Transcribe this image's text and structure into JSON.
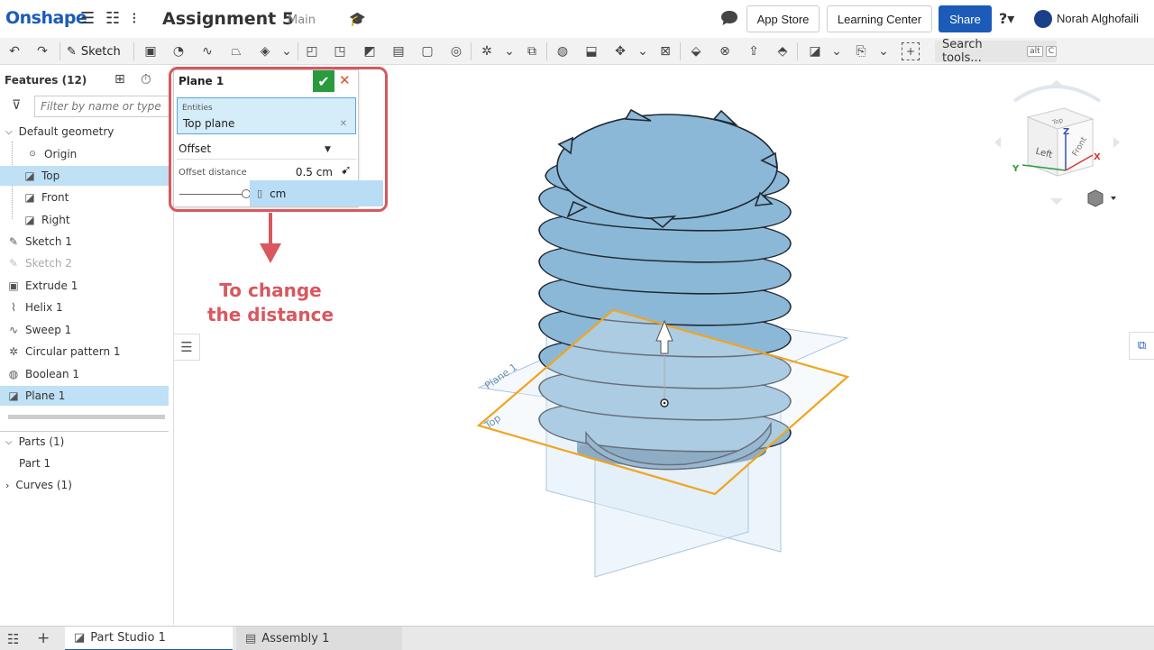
{
  "header": {
    "logo": "Onshape",
    "document_title": "Assignment 5",
    "branch": "Main",
    "app_store": "App Store",
    "learning_center": "Learning Center",
    "share": "Share",
    "user_name": "Norah Alghofaili"
  },
  "toolbar": {
    "sketch_label": "Sketch",
    "search_tools": "Search tools...",
    "search_shortcut_1": "alt",
    "search_shortcut_2": "C"
  },
  "features": {
    "title": "Features (12)",
    "filter_placeholder": "Filter by name or type",
    "default_geometry": "Default geometry",
    "items": [
      {
        "label": "Origin"
      },
      {
        "label": "Top"
      },
      {
        "label": "Front"
      },
      {
        "label": "Right"
      },
      {
        "label": "Sketch 1"
      },
      {
        "label": "Sketch 2"
      },
      {
        "label": "Extrude 1"
      },
      {
        "label": "Helix 1"
      },
      {
        "label": "Sweep 1"
      },
      {
        "label": "Circular pattern 1"
      },
      {
        "label": "Boolean 1"
      },
      {
        "label": "Plane 1"
      }
    ],
    "parts": "Parts (1)",
    "part_1": "Part 1",
    "curves": "Curves (1)"
  },
  "dialog": {
    "title": "Plane 1",
    "entities_label": "Entities",
    "entities_value": "Top plane",
    "type_value": "Offset",
    "offset_distance_label": "Offset distance",
    "offset_distance_value": "0.5 cm",
    "unit_option": "cm"
  },
  "annotation": {
    "line1": "To change",
    "line2": "the distance",
    "color": "#d9575e"
  },
  "viewcube": {
    "top": "Top",
    "left": "Left",
    "front": "Front",
    "axis_x": "X",
    "axis_y": "Y",
    "axis_z": "Z"
  },
  "scene_labels": {
    "plane_1": "Plane 1",
    "top": "Top"
  },
  "tabs": {
    "part_studio": "Part Studio 1",
    "assembly": "Assembly 1"
  },
  "colors": {
    "brand_blue": "#1c5bb8",
    "selection": "#bfe0f5",
    "part_blue": "#8cb8d8",
    "plane_orange": "#f0a51e"
  },
  "icons": {
    "menu": "hamburger-icon",
    "chat": "chat-icon",
    "help": "help-icon",
    "confirm": "check-icon",
    "cancel": "close-icon"
  }
}
